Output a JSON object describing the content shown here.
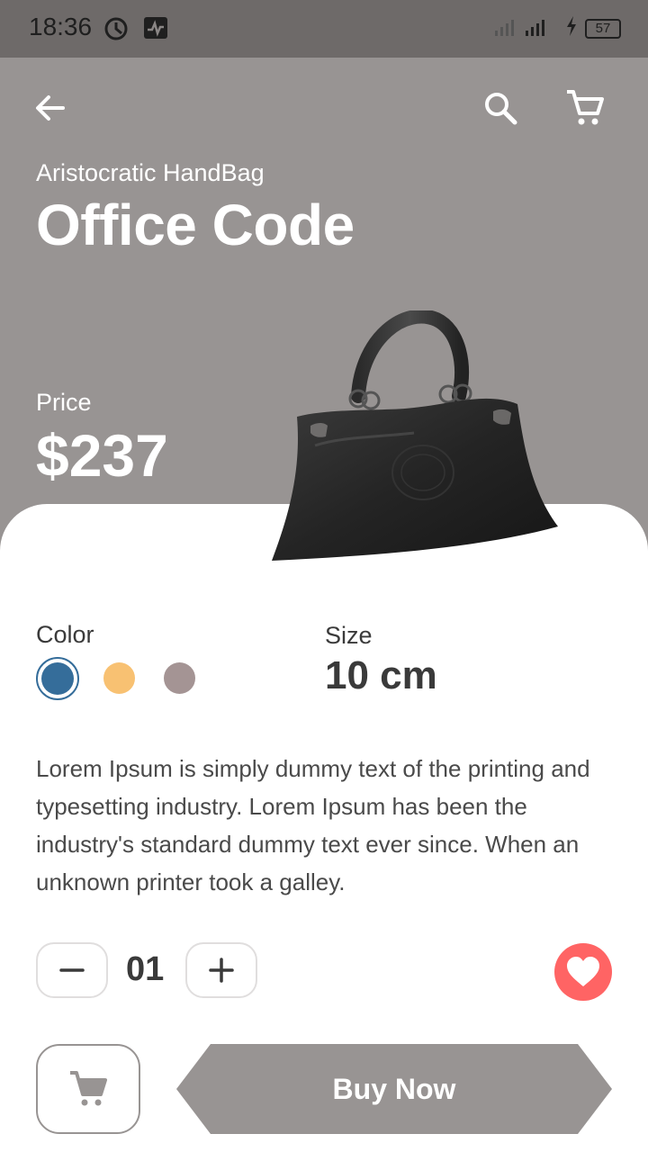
{
  "status_bar": {
    "time": "18:36",
    "battery": "57"
  },
  "header": {
    "back_icon": "arrow-left-icon",
    "search_icon": "search-icon",
    "cart_icon": "cart-icon"
  },
  "product": {
    "category": "Aristocratic HandBag",
    "name": "Office Code",
    "price_label": "Price",
    "price": "$237"
  },
  "options": {
    "color_label": "Color",
    "colors": [
      "#356d9a",
      "#f8c172",
      "#a49494"
    ],
    "selected_color_index": 0,
    "size_label": "Size",
    "size_value": "10 cm"
  },
  "description": "Lorem Ipsum is simply dummy text of the printing and typesetting industry. Lorem Ipsum has been the industry's standard dummy text ever since. When an unknown printer took a galley.",
  "quantity": {
    "minus": "−",
    "value": "01",
    "plus": "+"
  },
  "actions": {
    "buy_label": "Buy Now",
    "favorite_color": "#ff6464"
  },
  "theme": {
    "primary": "#989493"
  }
}
